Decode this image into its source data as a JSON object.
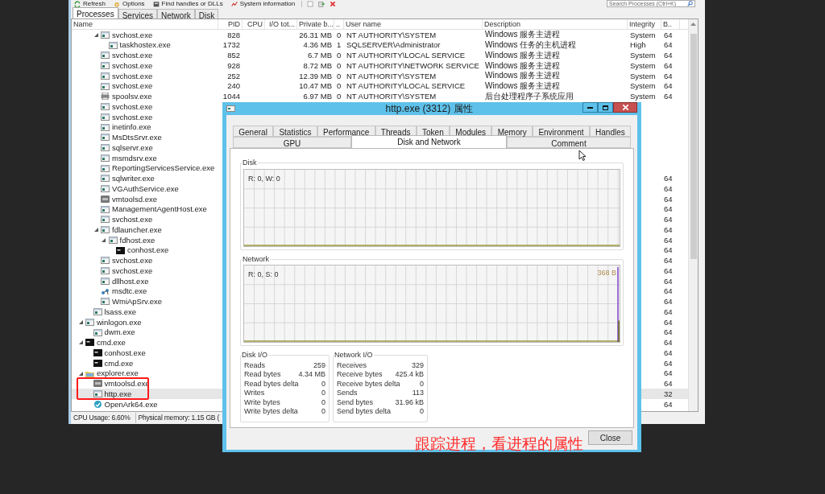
{
  "main_window": {
    "toolbar": [
      {
        "label": "Refresh",
        "kind": "refresh"
      },
      {
        "label": "Options",
        "kind": "options"
      },
      {
        "label": "Find handles or DLLs",
        "kind": "find"
      },
      {
        "label": "System information",
        "kind": "sysinfo"
      }
    ],
    "search": {
      "placeholder": "Search Processes (Ctrl+K)"
    },
    "tabs": [
      {
        "label": "Processes",
        "selected": true
      },
      {
        "label": "Services",
        "selected": false
      },
      {
        "label": "Network",
        "selected": false
      },
      {
        "label": "Disk",
        "selected": false
      }
    ],
    "columns": [
      "Name",
      "PID",
      "CPU",
      "I/O tot...",
      "Private b...",
      "..",
      "User name",
      "Description",
      "Integrity",
      "B.."
    ],
    "tree": [
      {
        "children": [
          {
            "children": [
              {
                "name": "svchost.exe",
                "kind": "app",
                "expanded": true,
                "selected": false,
                "pid": "828",
                "private_bytes": "26.31 MB",
                "session": "0",
                "user_name": "NT AUTHORITY\\SYSTEM",
                "description": "Windows 服务主进程",
                "integrity": "System",
                "bits": "64",
                "children": [
                  {
                    "name": "taskhostex.exe",
                    "kind": "app",
                    "selected": false,
                    "pid": "1732",
                    "private_bytes": "4.36 MB",
                    "session": "1",
                    "user_name": "SQLSERVER\\Administrator",
                    "description": "Windows 任务的主机进程",
                    "integrity": "High",
                    "bits": "64"
                  }
                ]
              },
              {
                "name": "svchost.exe",
                "kind": "app",
                "selected": false,
                "pid": "852",
                "private_bytes": "6.7 MB",
                "session": "0",
                "user_name": "NT AUTHORITY\\LOCAL SERVICE",
                "description": "Windows 服务主进程",
                "integrity": "System",
                "bits": "64"
              },
              {
                "name": "svchost.exe",
                "kind": "app",
                "selected": false,
                "pid": "928",
                "private_bytes": "8.72 MB",
                "session": "0",
                "user_name": "NT AUTHORITY\\NETWORK SERVICE",
                "description": "Windows 服务主进程",
                "integrity": "System",
                "bits": "64"
              },
              {
                "name": "svchost.exe",
                "kind": "app",
                "selected": false,
                "pid": "252",
                "private_bytes": "12.39 MB",
                "session": "0",
                "user_name": "NT AUTHORITY\\SYSTEM",
                "description": "Windows 服务主进程",
                "integrity": "System",
                "bits": "64"
              },
              {
                "name": "svchost.exe",
                "kind": "app",
                "selected": false,
                "pid": "240",
                "private_bytes": "10.47 MB",
                "session": "0",
                "user_name": "NT AUTHORITY\\LOCAL SERVICE",
                "description": "Windows 服务主进程",
                "integrity": "System",
                "bits": "64"
              },
              {
                "name": "spoolsv.exe",
                "kind": "printer",
                "selected": false,
                "pid": "1044",
                "private_bytes": "6.97 MB",
                "session": "0",
                "user_name": "NT AUTHORITY\\SYSTEM",
                "description": "后台处理程序子系统应用",
                "integrity": "System",
                "bits": "64"
              },
              {
                "name": "svchost.exe",
                "kind": "app",
                "selected": false
              },
              {
                "name": "svchost.exe",
                "kind": "app",
                "selected": false
              },
              {
                "name": "inetinfo.exe",
                "kind": "app",
                "selected": false
              },
              {
                "name": "MsDtsSrvr.exe",
                "kind": "app",
                "selected": false
              },
              {
                "name": "sqlservr.exe",
                "kind": "app",
                "selected": false
              },
              {
                "name": "msmdsrv.exe",
                "kind": "app",
                "selected": false
              },
              {
                "name": "ReportingServicesService.exe",
                "kind": "app",
                "selected": false
              },
              {
                "name": "sqlwriter.exe",
                "kind": "app",
                "selected": false,
                "bits": "64"
              },
              {
                "name": "VGAuthService.exe",
                "kind": "app",
                "selected": false,
                "bits": "64"
              },
              {
                "name": "vmtoolsd.exe",
                "kind": "vm",
                "selected": false,
                "bits": "64"
              },
              {
                "name": "ManagementAgentHost.exe",
                "kind": "app",
                "selected": false,
                "bits": "64"
              },
              {
                "name": "svchost.exe",
                "kind": "app",
                "selected": false,
                "bits": "64"
              },
              {
                "name": "fdlauncher.exe",
                "kind": "app",
                "expanded": true,
                "selected": false,
                "bits": "64",
                "children": [
                  {
                    "name": "fdhost.exe",
                    "kind": "app",
                    "expanded": true,
                    "selected": false,
                    "bits": "64",
                    "children": [
                      {
                        "name": "conhost.exe",
                        "kind": "console",
                        "selected": false,
                        "bits": "64"
                      }
                    ]
                  }
                ]
              },
              {
                "name": "svchost.exe",
                "kind": "app",
                "selected": false,
                "bits": "64"
              },
              {
                "name": "svchost.exe",
                "kind": "app",
                "selected": false,
                "bits": "64"
              },
              {
                "name": "dllhost.exe",
                "kind": "app",
                "selected": false,
                "bits": "64"
              },
              {
                "name": "msdtc.exe",
                "kind": "network",
                "selected": false,
                "bits": "64"
              },
              {
                "name": "WmiApSrv.exe",
                "kind": "app",
                "selected": false,
                "bits": "64"
              }
            ]
          },
          {
            "name": "lsass.exe",
            "kind": "app",
            "selected": false,
            "bits": "64"
          }
        ]
      },
      {
        "name": "winlogon.exe",
        "kind": "app",
        "expanded": true,
        "selected": false,
        "bits": "64",
        "children": [
          {
            "name": "dwm.exe",
            "kind": "app",
            "selected": false,
            "bits": "64"
          }
        ]
      },
      {
        "name": "cmd.exe",
        "kind": "console",
        "expanded": true,
        "selected": false,
        "bits": "64",
        "children": [
          {
            "name": "conhost.exe",
            "kind": "console",
            "selected": false,
            "bits": "64"
          },
          {
            "name": "cmd.exe",
            "kind": "console",
            "selected": false,
            "bits": "64"
          }
        ]
      },
      {
        "name": "explorer.exe",
        "kind": "folder",
        "expanded": true,
        "selected": false,
        "bits": "64",
        "children": [
          {
            "name": "vmtoolsd.exe",
            "kind": "vm",
            "selected": false,
            "bits": "64"
          },
          {
            "name": "http.exe",
            "kind": "app",
            "selected": true,
            "bits": "32"
          },
          {
            "name": "OpenArk64.exe",
            "kind": "shield",
            "selected": false,
            "bits": "64"
          }
        ]
      }
    ],
    "status_bar": [
      "CPU Usage: 6.60%",
      "Physical memory: 1.15 GB ("
    ]
  },
  "dialog": {
    "title": "http.exe (3312) 属性",
    "tab_rows": [
      [
        {
          "label": "General",
          "selected": false
        },
        {
          "label": "Statistics",
          "selected": false
        },
        {
          "label": "Performance",
          "selected": false
        },
        {
          "label": "Threads",
          "selected": false
        },
        {
          "label": "Token",
          "selected": false
        },
        {
          "label": "Modules",
          "selected": false
        },
        {
          "label": "Memory",
          "selected": false
        },
        {
          "label": "Environment",
          "selected": false
        },
        {
          "label": "Handles",
          "selected": false
        }
      ],
      [
        {
          "label": "GPU",
          "selected": false
        },
        {
          "label": "Disk and Network",
          "selected": true
        },
        {
          "label": "Comment",
          "selected": false
        }
      ]
    ],
    "disk_group": {
      "label": "Disk",
      "graph_label": "R: 0, W: 0"
    },
    "network_group": {
      "label": "Network",
      "graph_label": "R: 0, S: 0",
      "peak_label": "368 B"
    },
    "disk_io": {
      "label": "Disk I/O",
      "rows": [
        {
          "label": "Reads",
          "value": "259"
        },
        {
          "label": "Read bytes",
          "value": "4.34 MB"
        },
        {
          "label": "Read bytes delta",
          "value": "0"
        },
        {
          "label": "Writes",
          "value": "0"
        },
        {
          "label": "Write bytes",
          "value": "0"
        },
        {
          "label": "Write bytes delta",
          "value": "0"
        }
      ]
    },
    "network_io": {
      "label": "Network I/O",
      "rows": [
        {
          "label": "Receives",
          "value": "329"
        },
        {
          "label": "Receive bytes",
          "value": "425.4 kB"
        },
        {
          "label": "Receive bytes delta",
          "value": "0"
        },
        {
          "label": "Sends",
          "value": "113"
        },
        {
          "label": "Send bytes",
          "value": "31.96 kB"
        },
        {
          "label": "Send bytes delta",
          "value": "0"
        }
      ]
    },
    "close_button": "Close"
  },
  "caption": "跟踪进程，看进程的属性"
}
